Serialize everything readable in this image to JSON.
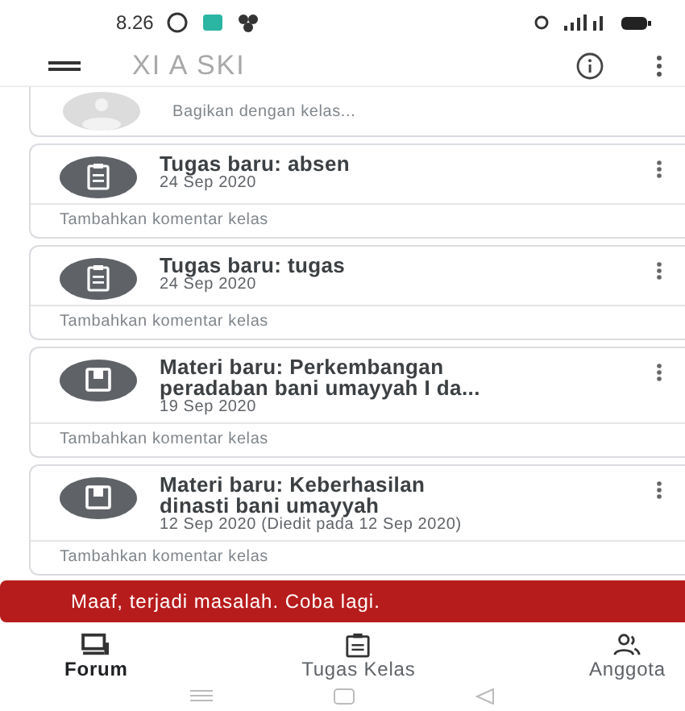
{
  "status_bar": {
    "time": "8.26"
  },
  "app_bar": {
    "title": "XI A SKI"
  },
  "share_prompt": {
    "placeholder": "Bagikan dengan kelas..."
  },
  "posts": [
    {
      "kind": "assignment",
      "title": "Tugas baru: absen",
      "date": "24 Sep 2020",
      "comment_prompt": "Tambahkan komentar kelas"
    },
    {
      "kind": "assignment",
      "title": "Tugas baru: tugas",
      "date": "24 Sep 2020",
      "comment_prompt": "Tambahkan komentar kelas"
    },
    {
      "kind": "material",
      "title": "Materi baru: Perkembangan peradaban bani umayyah I da...",
      "date": "19 Sep 2020",
      "comment_prompt": "Tambahkan komentar kelas"
    },
    {
      "kind": "material",
      "title": "Materi baru: Keberhasilan dinasti bani umayyah",
      "date": "12 Sep 2020 (Diedit pada 12 Sep 2020)",
      "comment_prompt": "Tambahkan komentar kelas"
    }
  ],
  "snackbar": {
    "message": "Maaf, terjadi masalah. Coba lagi."
  },
  "bottom_nav": [
    {
      "kind": "forum",
      "label": "Forum",
      "selected": true
    },
    {
      "kind": "classwork",
      "label": "Tugas Kelas",
      "selected": false
    },
    {
      "kind": "people",
      "label": "Anggota",
      "selected": false
    }
  ]
}
